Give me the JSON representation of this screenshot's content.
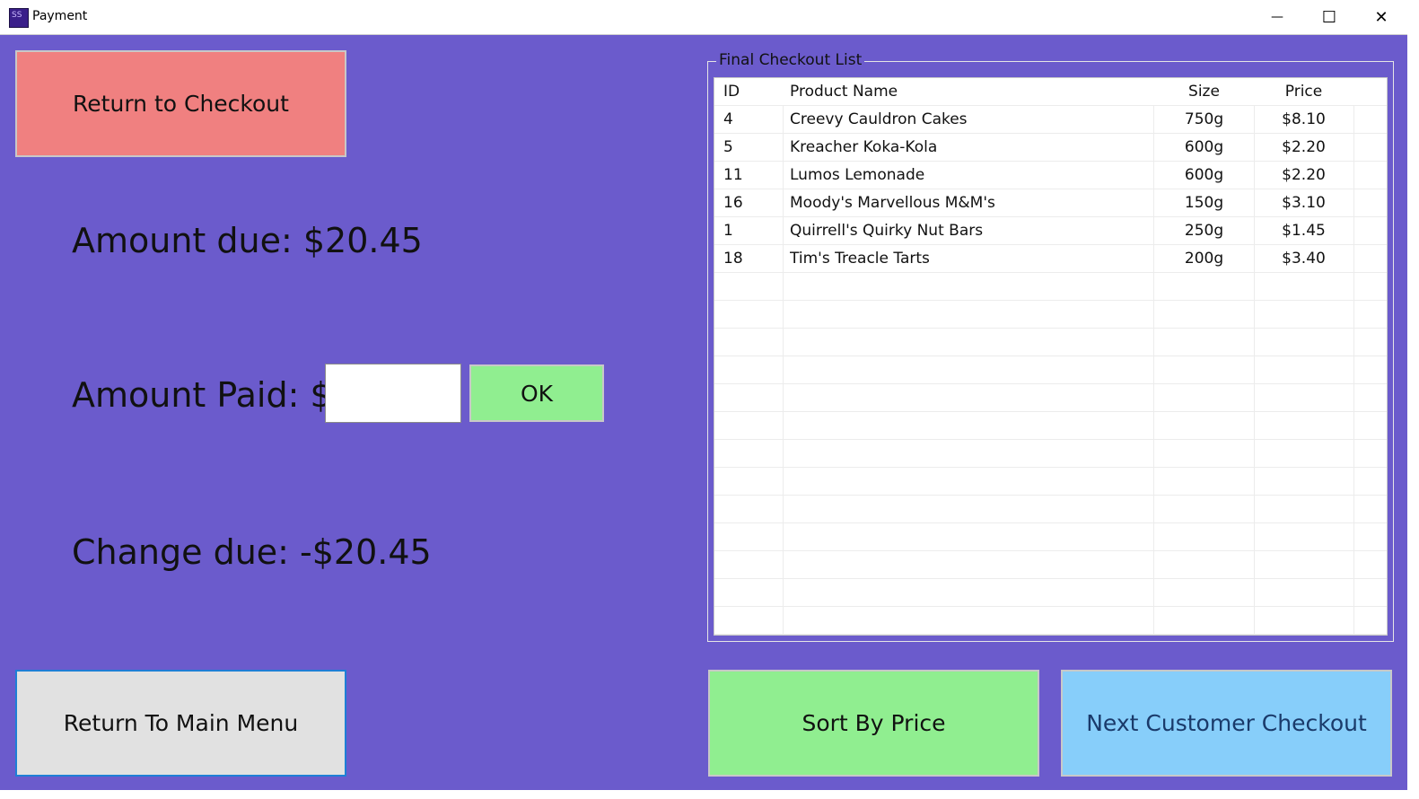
{
  "window": {
    "title": "Payment",
    "icon_text": "SS",
    "minimize_glyph": "—",
    "maximize_glyph": "☐",
    "close_glyph": "✕"
  },
  "left_panel": {
    "return_checkout_label": "Return to Checkout",
    "amount_due_text": "Amount due: $20.45",
    "amount_paid_label": "Amount Paid: $",
    "amount_paid_value": "",
    "ok_label": "OK",
    "change_due_text": "Change due: -$20.45",
    "return_main_label": "Return To Main Menu"
  },
  "checkout_list": {
    "group_title": "Final Checkout List",
    "columns": [
      "ID",
      "Product Name",
      "Size",
      "Price"
    ],
    "rows": [
      {
        "id": "4",
        "name": "Creevy Cauldron Cakes",
        "size": "750g",
        "price": "$8.10"
      },
      {
        "id": "5",
        "name": "Kreacher Koka-Kola",
        "size": "600g",
        "price": "$2.20"
      },
      {
        "id": "11",
        "name": "Lumos Lemonade",
        "size": "600g",
        "price": "$2.20"
      },
      {
        "id": "16",
        "name": "Moody's Marvellous M&M's",
        "size": "150g",
        "price": "$3.10"
      },
      {
        "id": "1",
        "name": "Quirrell's Quirky Nut Bars",
        "size": "250g",
        "price": "$1.45"
      },
      {
        "id": "18",
        "name": "Tim's Treacle Tarts",
        "size": "200g",
        "price": "$3.40"
      }
    ]
  },
  "bottom_buttons": {
    "sort_label": "Sort By Price",
    "next_customer_label": "Next Customer Checkout"
  },
  "colors": {
    "background": "#6b5bcc",
    "return_checkout": "#f08080",
    "ok": "#90ee90",
    "sort": "#90ee90",
    "next_customer": "#87cefa",
    "return_main": "#e1e1e1"
  }
}
